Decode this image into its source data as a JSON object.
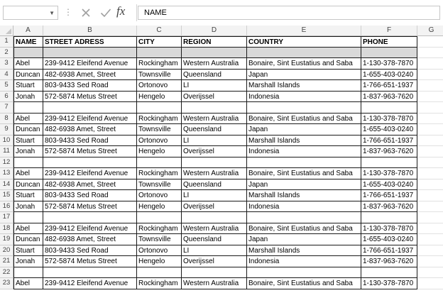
{
  "formula_bar": {
    "name_box_value": "",
    "formula_value": "NAME",
    "fx_label": "fx"
  },
  "columns": [
    "A",
    "B",
    "C",
    "D",
    "E",
    "F",
    "G"
  ],
  "header": [
    "NAME",
    "STREET ADRESS",
    "CITY",
    "REGION",
    "COUNTRY",
    "PHONE"
  ],
  "rows": [
    {
      "num": "1",
      "type": "header"
    },
    {
      "num": "2",
      "type": "grey"
    },
    {
      "num": "3",
      "type": "data",
      "values": [
        "Abel",
        "239-9412 Eleifend Avenue",
        "Rockingham",
        "Western Australia",
        "Bonaire, Sint Eustatius and Saba",
        "1-130-378-7870"
      ]
    },
    {
      "num": "4",
      "type": "data",
      "values": [
        "Duncan",
        "482-6938 Amet, Street",
        "Townsville",
        "Queensland",
        "Japan",
        "1-655-403-0240"
      ]
    },
    {
      "num": "5",
      "type": "data",
      "values": [
        "Stuart",
        "803-9433 Sed Road",
        "Ortonovo",
        "LI",
        "Marshall Islands",
        "1-766-651-1937"
      ]
    },
    {
      "num": "6",
      "type": "data",
      "values": [
        "Jonah",
        "572-5874 Metus Street",
        "Hengelo",
        "Overijssel",
        "Indonesia",
        "1-837-963-7620"
      ]
    },
    {
      "num": "7",
      "type": "blank"
    },
    {
      "num": "8",
      "type": "data",
      "values": [
        "Abel",
        "239-9412 Eleifend Avenue",
        "Rockingham",
        "Western Australia",
        "Bonaire, Sint Eustatius and Saba",
        "1-130-378-7870"
      ]
    },
    {
      "num": "9",
      "type": "data",
      "values": [
        "Duncan",
        "482-6938 Amet, Street",
        "Townsville",
        "Queensland",
        "Japan",
        "1-655-403-0240"
      ]
    },
    {
      "num": "10",
      "type": "data",
      "values": [
        "Stuart",
        "803-9433 Sed Road",
        "Ortonovo",
        "LI",
        "Marshall Islands",
        "1-766-651-1937"
      ]
    },
    {
      "num": "11",
      "type": "data",
      "values": [
        "Jonah",
        "572-5874 Metus Street",
        "Hengelo",
        "Overijssel",
        "Indonesia",
        "1-837-963-7620"
      ]
    },
    {
      "num": "12",
      "type": "blank"
    },
    {
      "num": "13",
      "type": "data",
      "values": [
        "Abel",
        "239-9412 Eleifend Avenue",
        "Rockingham",
        "Western Australia",
        "Bonaire, Sint Eustatius and Saba",
        "1-130-378-7870"
      ]
    },
    {
      "num": "14",
      "type": "data",
      "values": [
        "Duncan",
        "482-6938 Amet, Street",
        "Townsville",
        "Queensland",
        "Japan",
        "1-655-403-0240"
      ]
    },
    {
      "num": "15",
      "type": "data",
      "values": [
        "Stuart",
        "803-9433 Sed Road",
        "Ortonovo",
        "LI",
        "Marshall Islands",
        "1-766-651-1937"
      ]
    },
    {
      "num": "16",
      "type": "data",
      "values": [
        "Jonah",
        "572-5874 Metus Street",
        "Hengelo",
        "Overijssel",
        "Indonesia",
        "1-837-963-7620"
      ]
    },
    {
      "num": "17",
      "type": "blank"
    },
    {
      "num": "18",
      "type": "data",
      "values": [
        "Abel",
        "239-9412 Eleifend Avenue",
        "Rockingham",
        "Western Australia",
        "Bonaire, Sint Eustatius and Saba",
        "1-130-378-7870"
      ]
    },
    {
      "num": "19",
      "type": "data",
      "values": [
        "Duncan",
        "482-6938 Amet, Street",
        "Townsville",
        "Queensland",
        "Japan",
        "1-655-403-0240"
      ]
    },
    {
      "num": "20",
      "type": "data",
      "values": [
        "Stuart",
        "803-9433 Sed Road",
        "Ortonovo",
        "LI",
        "Marshall Islands",
        "1-766-651-1937"
      ]
    },
    {
      "num": "21",
      "type": "data",
      "values": [
        "Jonah",
        "572-5874 Metus Street",
        "Hengelo",
        "Overijssel",
        "Indonesia",
        "1-837-963-7620"
      ]
    },
    {
      "num": "22",
      "type": "blank"
    },
    {
      "num": "23",
      "type": "data",
      "values": [
        "Abel",
        "239-9412 Eleifend Avenue",
        "Rockingham",
        "Western Australia",
        "Bonaire, Sint Eustatius and Saba",
        "1-130-378-7870"
      ]
    }
  ],
  "colors": {
    "header_fill": "#d9d9d9",
    "gridline": "#1a1a1a",
    "heading_bg": "#f3f3f3"
  }
}
